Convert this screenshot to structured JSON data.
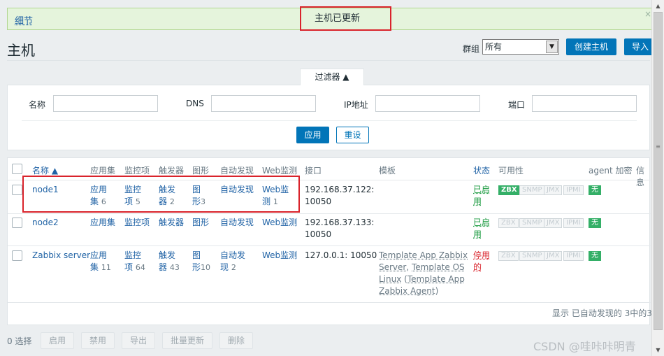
{
  "message": {
    "details": "细节",
    "text": "主机已更新",
    "close": "×"
  },
  "page": {
    "title": "主机"
  },
  "toolbar": {
    "group_label": "群组",
    "group_value": "所有",
    "create_host": "创建主机",
    "import": "导入"
  },
  "filter": {
    "tab_label": "过滤器 ▲",
    "name_label": "名称",
    "dns_label": "DNS",
    "ip_label": "IP地址",
    "port_label": "端口",
    "apply": "应用",
    "reset": "重设"
  },
  "table": {
    "headers": {
      "name": "名称 ▲",
      "applications": "应用集",
      "items": "监控项",
      "triggers": "触发器",
      "graphs": "图形",
      "discovery": "自动发现",
      "web": "Web监测",
      "interface": "接口",
      "templates": "模板",
      "status": "状态",
      "availability": "可用性",
      "agent_encryption": "agent 加密",
      "info": "信息"
    },
    "rows": [
      {
        "name": "node1",
        "app_l1": "应用",
        "app_l2": "集",
        "app_count": "6",
        "items_l1": "监控",
        "items_l2": "项",
        "items_count": "5",
        "trig_l1": "触发",
        "trig_l2": "器",
        "trig_count": "2",
        "graph_l1": "图",
        "graph_l2": "形",
        "graph_count": "3",
        "discovery": "自动发现",
        "web_l1": "Web监",
        "web_l2": "测",
        "web_count": "1",
        "iface_l1": "192.168.37.122:",
        "iface_l2": "10050",
        "status_l1": "已启",
        "status_l2": "用",
        "badges": [
          "ZBX",
          "SNMP",
          "JMX",
          "IPMI"
        ],
        "encryption": "无"
      },
      {
        "name": "node2",
        "apps": "应用集",
        "items": "监控项",
        "triggers": "触发器",
        "graphs": "图形",
        "discovery": "自动发现",
        "web": "Web监测",
        "iface_l1": "192.168.37.133:",
        "iface_l2": "10050",
        "status_l1": "已启",
        "status_l2": "用",
        "badges": [
          "ZBX",
          "SNMP",
          "JMX",
          "IPMI"
        ],
        "encryption": "无"
      },
      {
        "name": "Zabbix server",
        "app_l1": "应用",
        "app_l2": "集",
        "app_count": "11",
        "items_l1": "监控",
        "items_l2": "项",
        "items_count": "64",
        "trig_l1": "触发",
        "trig_l2": "器",
        "trig_count": "43",
        "graph_l1": "图",
        "graph_l2": "形",
        "graph_count": "10",
        "disc_l1": "自动发",
        "disc_l2": "现",
        "disc_count": "2",
        "web": "Web监测",
        "iface": "127.0.0.1: 10050",
        "tpl_l1": "Template App Zabbix",
        "tpl_l2a": "Server",
        "tpl_l2b": ", ",
        "tpl_l2c": "Template OS",
        "tpl_l3a": "Linux",
        "tpl_l3b": " (",
        "tpl_l3c": "Template App",
        "tpl_l4a": "Zabbix Agent",
        "tpl_l4b": ")",
        "status_l1": "停用",
        "status_l2": "的",
        "badges": [
          "ZBX",
          "SNMP",
          "JMX",
          "IPMI"
        ],
        "encryption": "无"
      }
    ],
    "footer": "显示 已自动发现的 3中的3"
  },
  "mass": {
    "selected": "0 选择",
    "enable": "启用",
    "disable": "禁用",
    "export": "导出",
    "mass_update": "批量更新",
    "delete": "删除"
  },
  "watermark": "CSDN @哇咔咔明青",
  "colors": {
    "accent": "#0275b8",
    "success_bg": "#e5f4dc",
    "green": "#34af67",
    "red": "#d9232b",
    "link": "#1f62a5"
  }
}
